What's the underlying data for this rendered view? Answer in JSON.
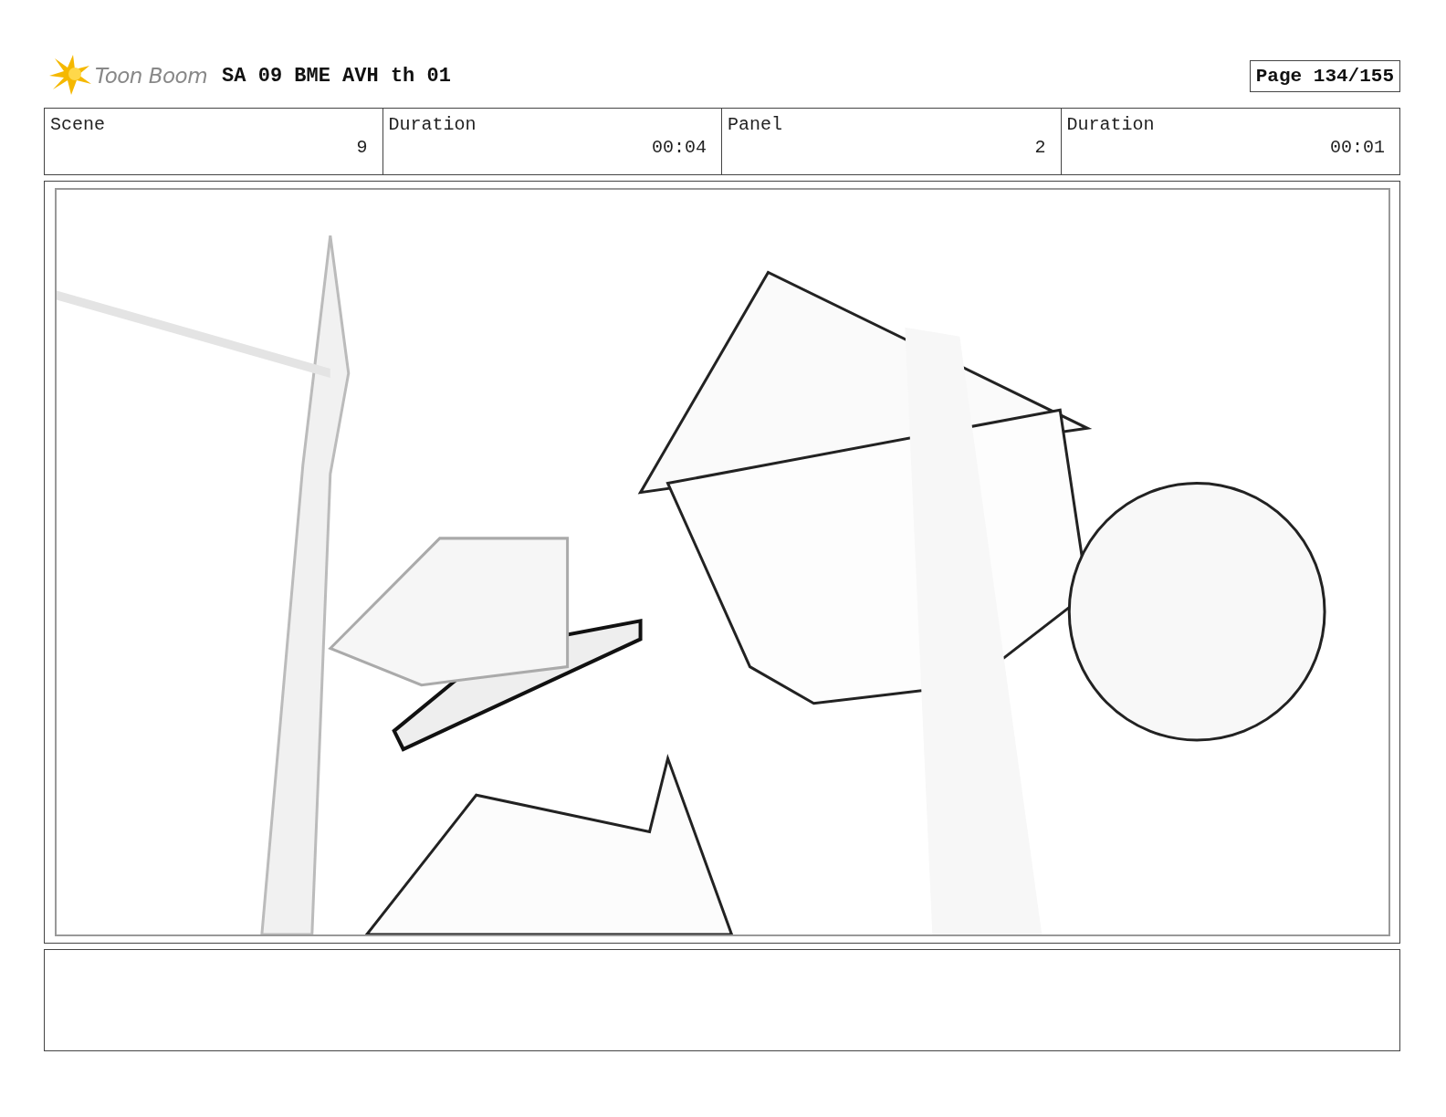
{
  "header": {
    "logo_text": "Toon Boom",
    "title": "SA 09 BME AVH th 01",
    "page": "Page 134/155"
  },
  "info": [
    {
      "label": "Scene",
      "value": "9"
    },
    {
      "label": "Duration",
      "value": "00:04"
    },
    {
      "label": "Panel",
      "value": "2"
    },
    {
      "label": "Duration",
      "value": "00:01"
    }
  ]
}
